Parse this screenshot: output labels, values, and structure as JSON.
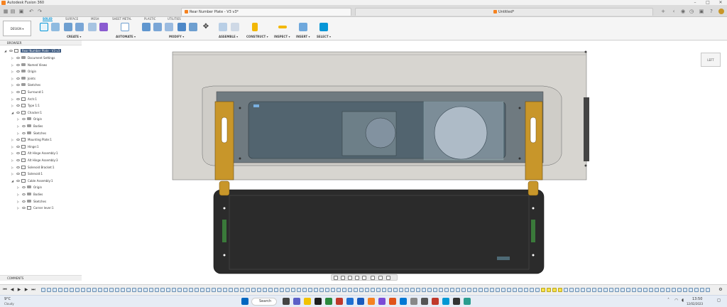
{
  "window": {
    "title": "Autodesk Fusion 360",
    "minimize": "–",
    "maximize": "□",
    "close": "✕"
  },
  "tabs": [
    {
      "label": "Rear Number Plate - V3 v3*",
      "active": true
    },
    {
      "label": "Untitled*",
      "active": false
    }
  ],
  "workspace": {
    "label": "DESIGN ▾"
  },
  "toolbar_tabs": [
    "SOLID",
    "SURFACE",
    "MESH",
    "SHEET METAL",
    "PLASTIC",
    "UTILITIES"
  ],
  "toolbar_groups": [
    "CREATE ▾",
    "AUTOMATE ▾",
    "MODIFY ▾",
    "ASSEMBLE ▾",
    "CONSTRUCT ▾",
    "INSPECT ▾",
    "INSERT ▾",
    "SELECT ▾"
  ],
  "browser": {
    "header": "BROWSER",
    "root": "Rear Number Plate - V3 v3",
    "items": [
      {
        "label": "Document Settings",
        "depth": 1,
        "kind": "folder"
      },
      {
        "label": "Named Views",
        "depth": 1,
        "kind": "folder"
      },
      {
        "label": "Origin",
        "depth": 1,
        "kind": "folder"
      },
      {
        "label": "Joints",
        "depth": 1,
        "kind": "folder"
      },
      {
        "label": "Sketches",
        "depth": 1,
        "kind": "folder"
      },
      {
        "label": "Surround:1",
        "depth": 1,
        "kind": "comp"
      },
      {
        "label": "Arch:1",
        "depth": 1,
        "kind": "comp"
      },
      {
        "label": "Type 1:1",
        "depth": 1,
        "kind": "comp"
      },
      {
        "label": "Chacker:1",
        "depth": 1,
        "kind": "comp",
        "expanded": true
      },
      {
        "label": "Origin",
        "depth": 2,
        "kind": "folder"
      },
      {
        "label": "Bodies",
        "depth": 2,
        "kind": "folder"
      },
      {
        "label": "Sketches",
        "depth": 2,
        "kind": "folder"
      },
      {
        "label": "Mounting Plate:1",
        "depth": 1,
        "kind": "comp"
      },
      {
        "label": "Hinge:1",
        "depth": 1,
        "kind": "comp"
      },
      {
        "label": "Alt Hinge Assembly:1",
        "depth": 1,
        "kind": "comp"
      },
      {
        "label": "Alt Hinge Assembly:3",
        "depth": 1,
        "kind": "comp"
      },
      {
        "label": "Solenoid Bracket:1",
        "depth": 1,
        "kind": "comp"
      },
      {
        "label": "Solenoid:1",
        "depth": 1,
        "kind": "comp"
      },
      {
        "label": "Cable Assembly:1",
        "depth": 1,
        "kind": "comp",
        "expanded": true
      },
      {
        "label": "Origin",
        "depth": 2,
        "kind": "folder"
      },
      {
        "label": "Bodies",
        "depth": 2,
        "kind": "folder"
      },
      {
        "label": "Sketches",
        "depth": 2,
        "kind": "folder"
      },
      {
        "label": "Corner lever:1",
        "depth": 2,
        "kind": "comp"
      }
    ]
  },
  "comments": {
    "label": "COMMENTS"
  },
  "viewcube": {
    "label": "LEFT"
  },
  "taskbar": {
    "weather_temp": "9°C",
    "weather_desc": "Cloudy",
    "search": "Search",
    "time": "13:50",
    "date": "12/02/2023"
  },
  "colors": {
    "accent": "#0696d7",
    "brand": "#f58220",
    "hinge": "#c8962a",
    "plate": "#2b2b2b"
  }
}
